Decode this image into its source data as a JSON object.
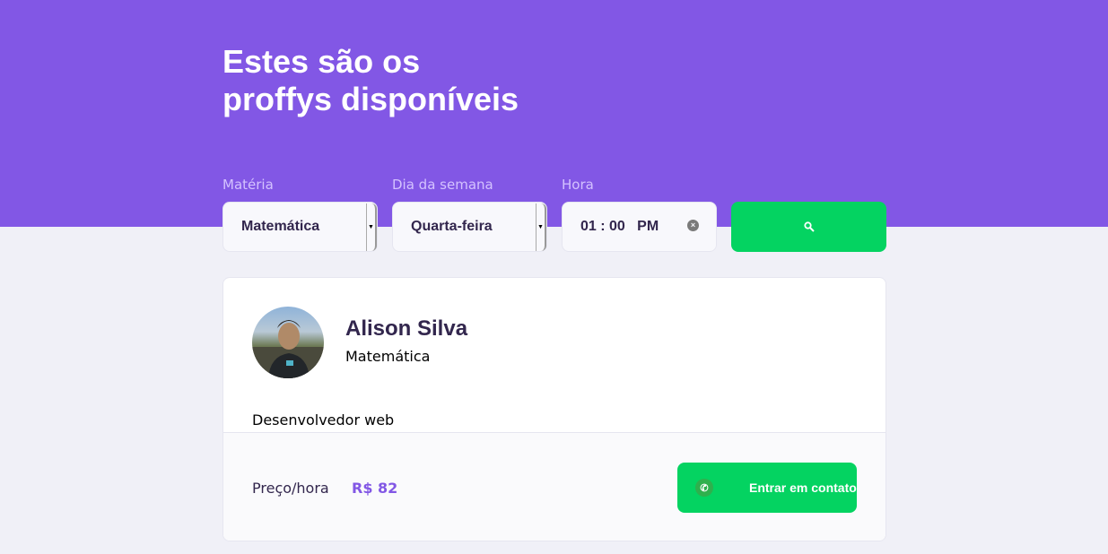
{
  "header": {
    "title_line1": "Estes são os",
    "title_line2": "proffys disponíveis"
  },
  "filters": {
    "subject_label": "Matéria",
    "subject_value": "Matemática",
    "weekday_label": "Dia da semana",
    "weekday_value": "Quarta-feira",
    "time_label": "Hora",
    "time_value": "01 : 00   PM"
  },
  "search_button": {
    "icon": "search-icon"
  },
  "teacher": {
    "name": "Alison Silva",
    "subject": "Matemática",
    "bio": "Desenvolvedor web",
    "price_label": "Preço/hora",
    "price_value": "R$ 82",
    "contact_label": "Entrar em contato",
    "contact_icon": "whatsapp-icon"
  },
  "colors": {
    "primary": "#8257e5",
    "secondary": "#04d361",
    "background": "#f0f0f7",
    "title_text": "#32264d"
  }
}
